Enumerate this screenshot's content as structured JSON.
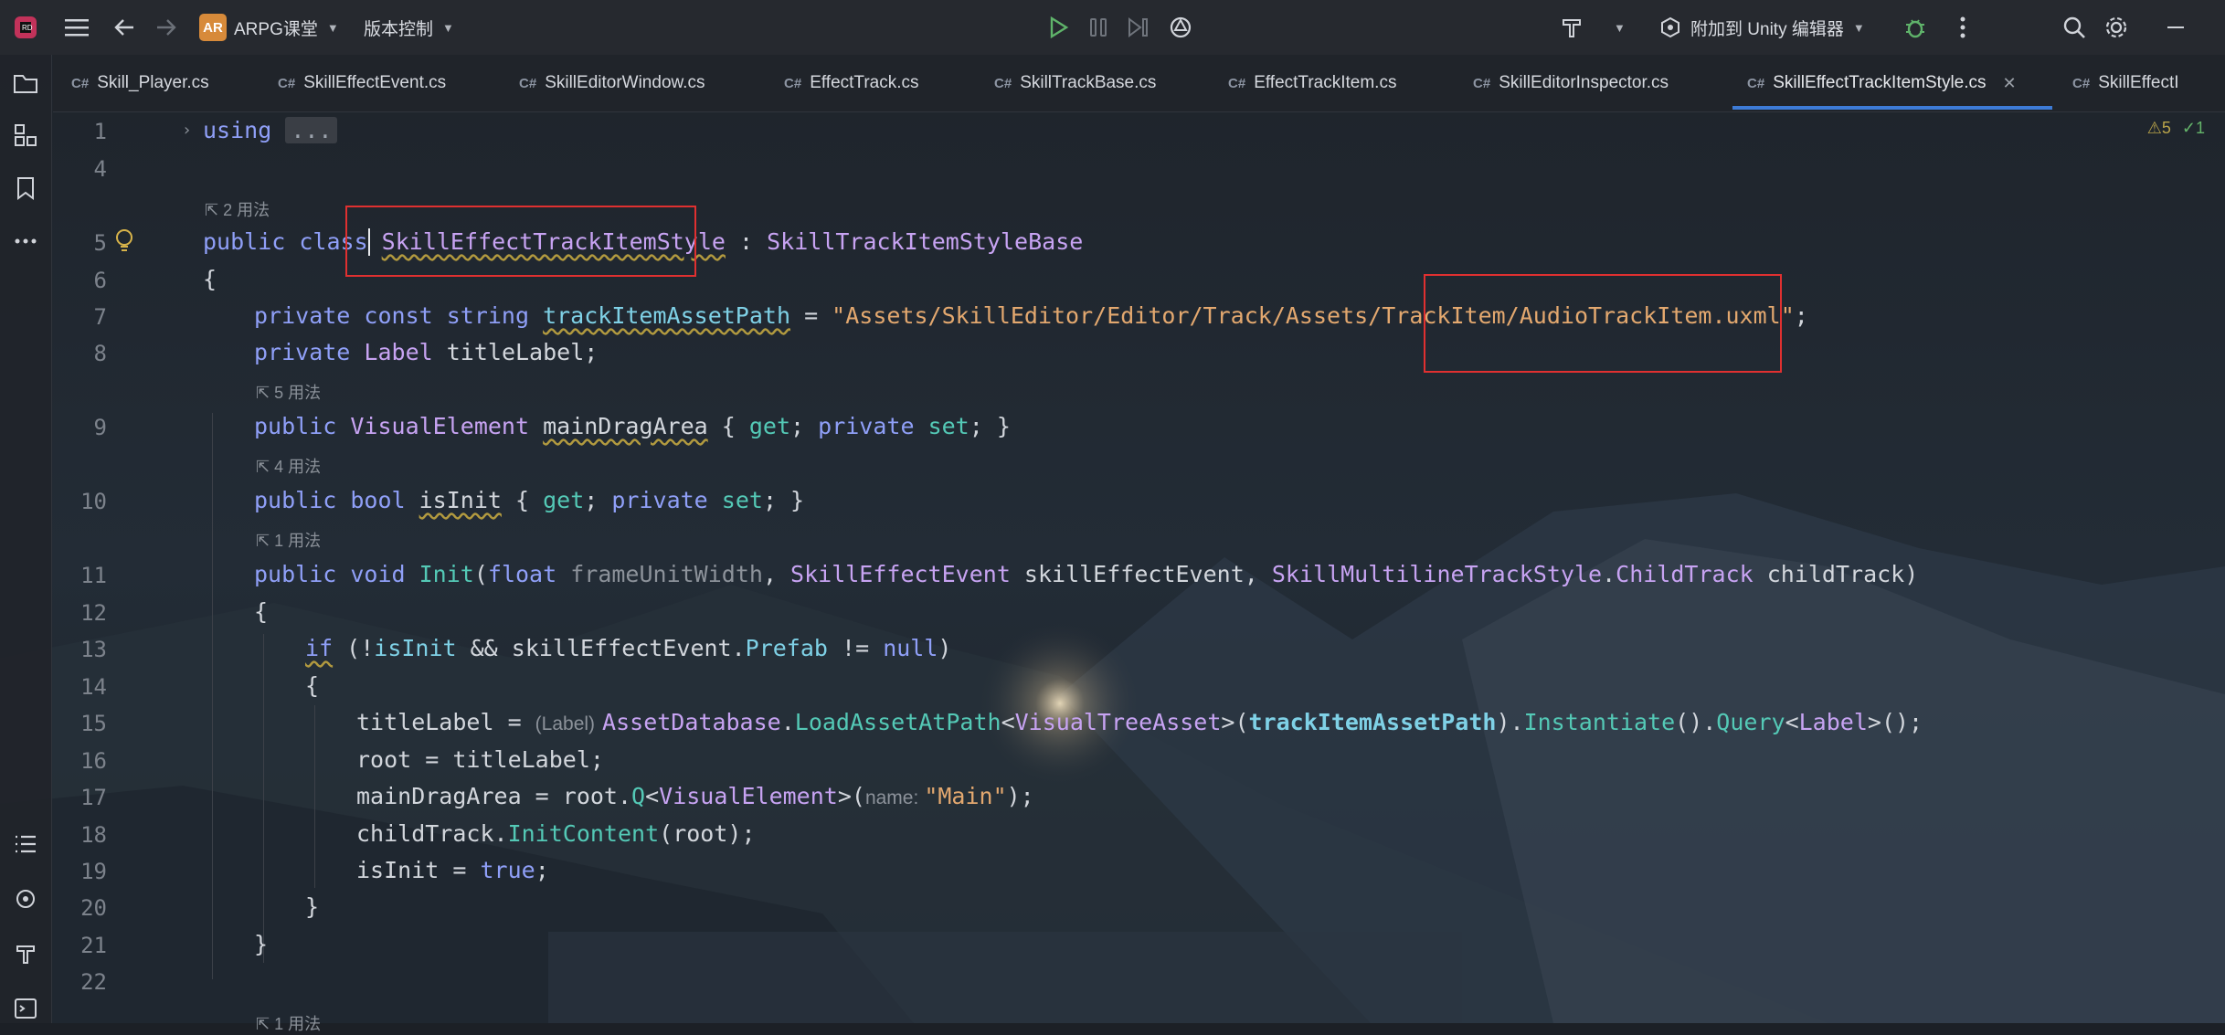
{
  "titlebar": {
    "project_badge": "AR",
    "project_name": "ARPG课堂",
    "vcs_label": "版本控制",
    "attach_label": "附加到 Unity 编辑器"
  },
  "tabs": [
    {
      "label": "Skill_Player.cs"
    },
    {
      "label": "SkillEffectEvent.cs"
    },
    {
      "label": "SkillEditorWindow.cs"
    },
    {
      "label": "EffectTrack.cs"
    },
    {
      "label": "SkillTrackBase.cs"
    },
    {
      "label": "EffectTrackItem.cs"
    },
    {
      "label": "SkillEditorInspector.cs"
    },
    {
      "label": "SkillEffectTrackItemStyle.cs"
    },
    {
      "label": "SkillEffectI"
    }
  ],
  "tab_prefix": "C#",
  "inspections": {
    "warnings": "⚠5",
    "ok": "✓1"
  },
  "editor": {
    "line_numbers": [
      "1",
      "4",
      "5",
      "6",
      "7",
      "8",
      "9",
      "10",
      "11",
      "12",
      "13",
      "14",
      "15",
      "16",
      "17",
      "18",
      "19",
      "20",
      "21",
      "22"
    ],
    "usage_hints": [
      "2 用法",
      "5 用法",
      "4 用法",
      "1 用法",
      "1 用法"
    ],
    "inlay_hints": {
      "label_cast": "(Label)",
      "name_param": "name:"
    },
    "line1": {
      "kw": "using",
      "fold": "..."
    },
    "line5": {
      "kw": "public class ",
      "name": "SkillEffectTrackItemStyle",
      "sep": " : ",
      "base": "SkillTrackItemStyleBase"
    },
    "line6": "{",
    "line7": {
      "kw": "private const string ",
      "name": "trackItemAssetPath",
      "eq": " = ",
      "str": "\"Assets/SkillEditor/Editor/Track/Assets/TrackItem/AudioTrackItem.uxml\"",
      "end": ";"
    },
    "line8": {
      "kw": "private ",
      "type": "Label",
      "rest": " titleLabel;"
    },
    "line9": {
      "kw": "public ",
      "type": "VisualElement",
      "sp": " ",
      "name": "mainDragArea",
      "rest1": " { ",
      "get": "get",
      "mid": "; ",
      "pv": "private ",
      "set": "set",
      "rest2": "; }"
    },
    "line10": {
      "kw": "public bool ",
      "name": "isInit",
      "rest1": " { ",
      "get": "get",
      "mid": "; ",
      "pv": "private ",
      "set": "set",
      "rest2": "; }"
    },
    "line11": {
      "kw": "public void ",
      "fn": "Init",
      "p1": "(",
      "kw2": "float ",
      "arg1": "frameUnitWidth",
      "c1": ", ",
      "t1": "SkillEffectEvent",
      "a2": " skillEffectEvent, ",
      "t2": "SkillMultilineTrackStyle",
      "dot": ".",
      "t3": "ChildTrack",
      "a3": " childTrack)"
    },
    "line12": "{",
    "line13": {
      "kw": "if",
      "p1": " (!",
      "f1": "isInit",
      "p2": " && skillEffectEvent.",
      "f2": "Prefab",
      "p3": " != ",
      "kw2": "null",
      "p4": ")"
    },
    "line14": "{",
    "line15": {
      "a": "titleLabel = ",
      "t1": "AssetDatabase",
      "d1": ".",
      "fn1": "LoadAssetAtPath",
      "lt": "<",
      "t2": "VisualTreeAsset",
      "gt": ">(",
      "f1": "trackItemAssetPath",
      "d2": ").",
      "fn2": "Instantiate",
      "d3": "().",
      "fn3": "Query",
      "lt2": "<",
      "t3": "Label",
      "end": ">();"
    },
    "line16": {
      "a": "root = titleLabel;"
    },
    "line17": {
      "a": "mainDragArea = root.",
      "fn": "Q",
      "lt": "<",
      "t": "VisualElement",
      "gt": ">(",
      "str": "\"Main\"",
      "end": ");"
    },
    "line18": {
      "a": "childTrack.",
      "fn": "InitContent",
      "end": "(root);"
    },
    "line19": {
      "a": "isInit = ",
      "kw": "true",
      "end": ";"
    },
    "line20": "}",
    "line21": "}"
  },
  "colors": {
    "accent": "#3d7bd6",
    "highlight_box": "#e03030"
  }
}
